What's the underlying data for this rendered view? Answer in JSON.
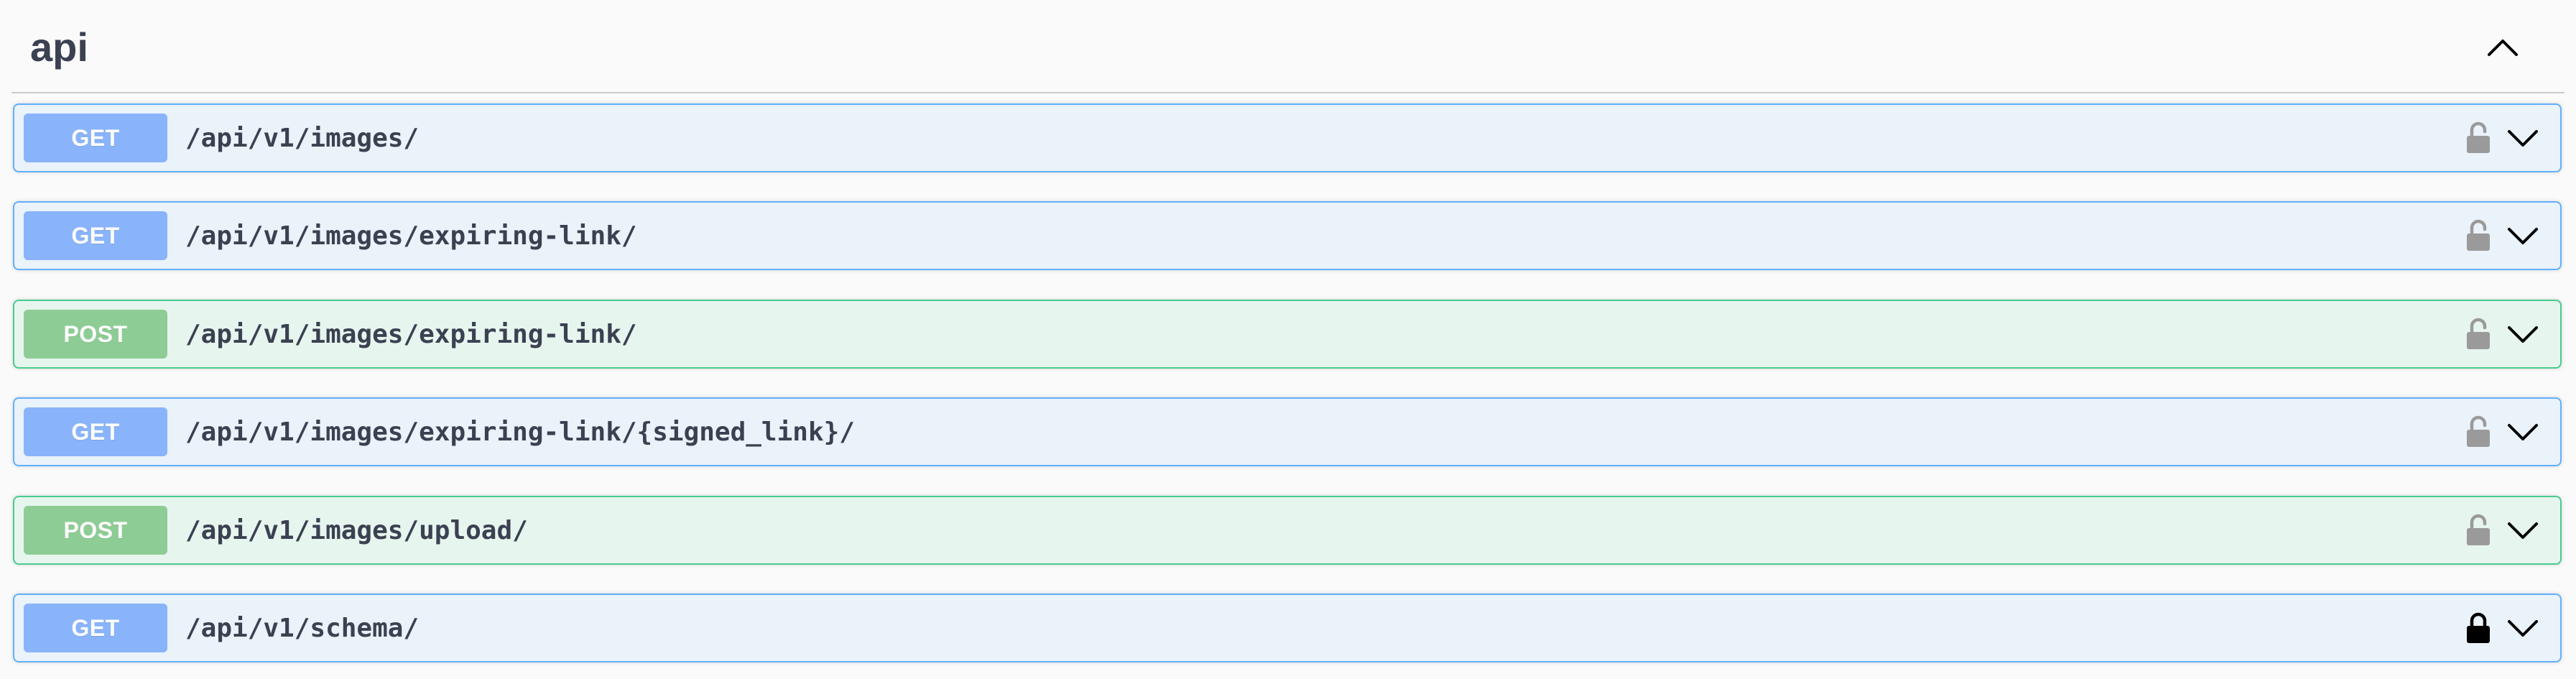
{
  "section": {
    "title": "api",
    "collapse_icon": "chevron-up-icon"
  },
  "colors": {
    "get_accent": "#61affe",
    "get_badge": "#89b4fb",
    "post_accent": "#49cc90",
    "post_badge": "#8dcd95",
    "lock_unlocked": "#9a9a9a",
    "lock_locked": "#000000"
  },
  "operations": [
    {
      "method": "GET",
      "path": "/api/v1/images/",
      "lock": "unlocked-lock-icon"
    },
    {
      "method": "GET",
      "path": "/api/v1/images/expiring-link/",
      "lock": "unlocked-lock-icon"
    },
    {
      "method": "POST",
      "path": "/api/v1/images/expiring-link/",
      "lock": "unlocked-lock-icon"
    },
    {
      "method": "GET",
      "path": "/api/v1/images/expiring-link/{signed_link}/",
      "lock": "unlocked-lock-icon"
    },
    {
      "method": "POST",
      "path": "/api/v1/images/upload/",
      "lock": "unlocked-lock-icon"
    },
    {
      "method": "GET",
      "path": "/api/v1/schema/",
      "lock": "locked-lock-icon"
    }
  ]
}
